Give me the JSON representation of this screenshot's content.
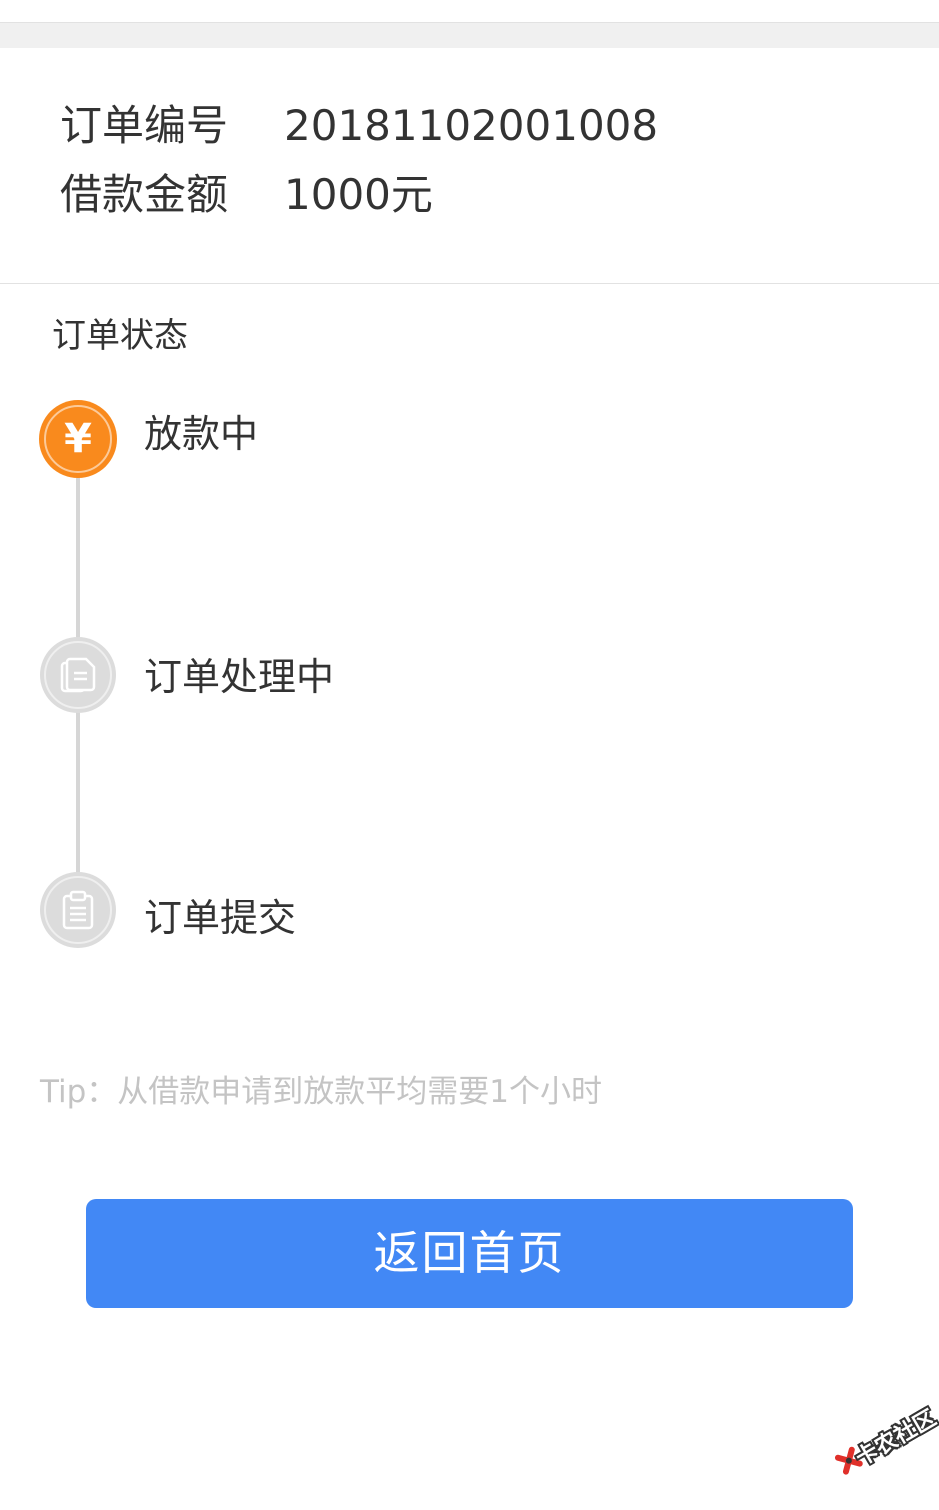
{
  "order_info": {
    "order_number_label": "订单编号",
    "order_number_value": "20181102001008",
    "loan_amount_label": "借款金额",
    "loan_amount_value": "1000元"
  },
  "status": {
    "title": "订单状态",
    "steps": [
      {
        "label": "放款中",
        "icon": "yen-icon",
        "state": "active",
        "glyph": "¥"
      },
      {
        "label": "订单处理中",
        "icon": "documents-icon",
        "state": "inactive"
      },
      {
        "label": "订单提交",
        "icon": "clipboard-icon",
        "state": "inactive"
      }
    ]
  },
  "tip": "Tip：从借款申请到放款平均需要1个小时",
  "home_button_label": "返回首页",
  "watermark": {
    "text": "卡农社区"
  },
  "colors": {
    "active_orange": "#f98a1d",
    "inactive_gray": "#dcdcdc",
    "button_blue": "#4288f5",
    "tip_gray": "#c4c4c4"
  }
}
